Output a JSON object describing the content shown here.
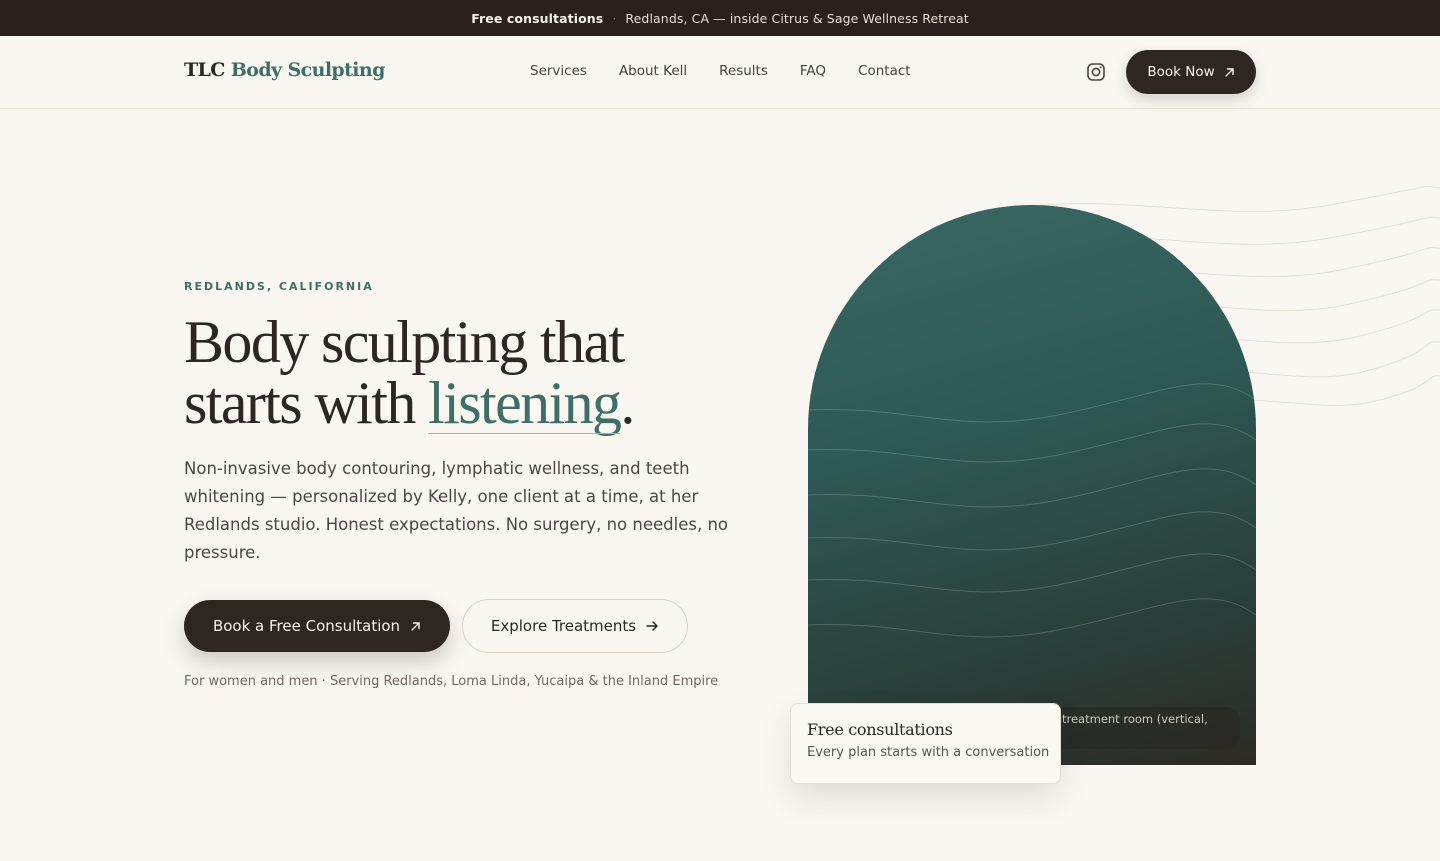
{
  "announcement": {
    "highlight": "Free consultations",
    "separator": "·",
    "text": "Redlands, CA — inside Citrus & Sage Wellness Retreat"
  },
  "header": {
    "logo_prefix": "TLC",
    "logo_accent": "Body Sculpting",
    "nav": [
      "Services",
      "About Kell",
      "Results",
      "FAQ",
      "Contact"
    ],
    "instagram_icon": "instagram-icon",
    "book_now_label": "Book Now",
    "book_now_icon": "arrow-up-right-icon"
  },
  "hero": {
    "eyebrow": "REDLANDS, CALIFORNIA",
    "headline_line1": "Body sculpting that",
    "headline_line2_start": "starts with ",
    "headline_highlight": "listening",
    "headline_end": ".",
    "subtitle": "Non-invasive body contouring, lymphatic wellness, and teeth whitening — personalized by Kelly, one client at a time, at her Redlands studio. Honest expectations. No surgery, no needles, no pressure.",
    "primary_cta": "Book a Free Consultation",
    "primary_cta_icon": "arrow-up-right-icon",
    "secondary_cta": "Explore Treatments",
    "secondary_cta_icon": "arrow-right-icon",
    "note": "For women and men · Serving Redlands, Loma Linda, Yucaipa & the Inland Empire"
  },
  "visual": {
    "image_caption": "treatment room (vertical,",
    "card_title": "Free consultations",
    "card_subtitle": "Every plan starts with a conversation"
  },
  "colors": {
    "dark": "#2e2620",
    "accent_green": "#3e6f66",
    "background": "#faf7f2"
  }
}
